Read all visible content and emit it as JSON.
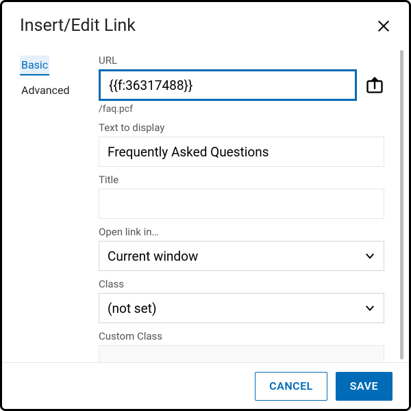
{
  "dialog": {
    "title": "Insert/Edit Link"
  },
  "tabs": {
    "basic": "Basic",
    "advanced": "Advanced"
  },
  "labels": {
    "url": "URL",
    "filepath": "/faq.pcf",
    "text": "Text to display",
    "title": "Title",
    "openin": "Open link in…",
    "class": "Class",
    "customclass": "Custom Class"
  },
  "values": {
    "url": "{{f:36317488}}",
    "text": "Frequently Asked Questions",
    "title": "",
    "openin": "Current window",
    "class": "(not set)",
    "customclass": ""
  },
  "buttons": {
    "cancel": "CANCEL",
    "save": "SAVE"
  }
}
